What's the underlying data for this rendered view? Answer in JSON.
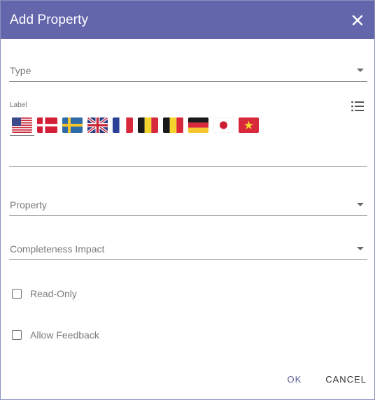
{
  "dialog": {
    "title": "Add Property"
  },
  "fields": {
    "type": {
      "placeholder": "Type"
    },
    "label": {
      "caption": "Label"
    },
    "property": {
      "placeholder": "Property"
    },
    "completeness": {
      "placeholder": "Completeness Impact"
    }
  },
  "flags": [
    {
      "name": "us-flag-icon",
      "country": "United States",
      "active": true
    },
    {
      "name": "denmark-flag-icon",
      "country": "Denmark"
    },
    {
      "name": "sweden-flag-icon",
      "country": "Sweden"
    },
    {
      "name": "uk-flag-icon",
      "country": "United Kingdom"
    },
    {
      "name": "france-flag-icon",
      "country": "France"
    },
    {
      "name": "belgium-flag-icon",
      "country": "Belgium"
    },
    {
      "name": "belgium-flag-icon-2",
      "country": "Belgium"
    },
    {
      "name": "germany-flag-icon",
      "country": "Germany"
    },
    {
      "name": "japan-flag-icon",
      "country": "Japan"
    },
    {
      "name": "vietnam-flag-icon",
      "country": "Vietnam"
    }
  ],
  "checkboxes": {
    "read_only": {
      "label": "Read-Only",
      "checked": false
    },
    "allow_feedback": {
      "label": "Allow Feedback",
      "checked": false
    }
  },
  "actions": {
    "ok_label": "OK",
    "cancel_label": "CANCEL"
  },
  "colors": {
    "header": "#6466ac",
    "ok": "#5f6299"
  }
}
